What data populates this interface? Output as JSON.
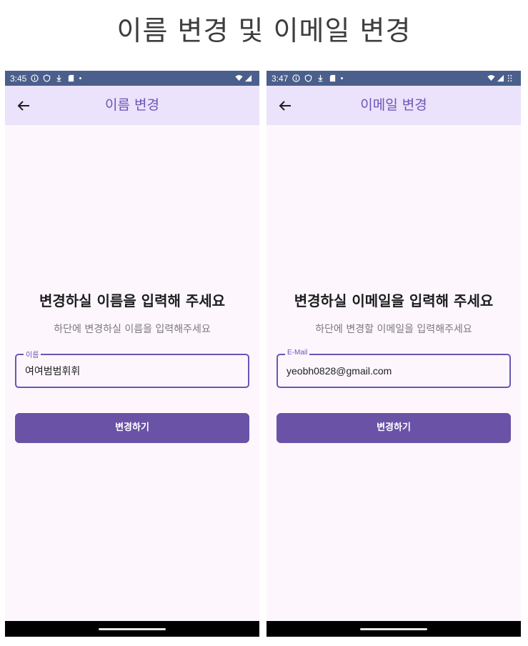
{
  "page_title": "이름 변경 및 이메일 변경",
  "screens": [
    {
      "status_bar": {
        "time": "3:45",
        "icons_left": [
          "info-circle-icon",
          "shield-icon",
          "download-icon",
          "sd-card-icon",
          "dot-icon"
        ],
        "icons_right": [
          "wifi-icon",
          "signal-icon"
        ]
      },
      "top_bar": {
        "title": "이름 변경",
        "back_icon": "arrow-back-icon"
      },
      "heading": "변경하실 이름을 입력해 주세요",
      "subheading": "하단에 변경하실 이름을 입력해주세요",
      "field": {
        "label": "이름",
        "value": "여여범범휘휘"
      },
      "button_label": "변경하기"
    },
    {
      "status_bar": {
        "time": "3:47",
        "icons_left": [
          "info-circle-icon",
          "shield-icon",
          "download-icon",
          "sd-card-icon",
          "dot-icon"
        ],
        "icons_right": [
          "wifi-icon",
          "signal-icon",
          "grid-dots-icon"
        ]
      },
      "top_bar": {
        "title": "이메일 변경",
        "back_icon": "arrow-back-icon"
      },
      "heading": "변경하실 이메일을 입력해 주세요",
      "subheading": "하단에 변경할 이메일을 입력해주세요",
      "field": {
        "label": "E-Mail",
        "value": "yeobh0828@gmail.com"
      },
      "button_label": "변경하기"
    }
  ],
  "colors": {
    "status_bar": "#4b5f8c",
    "top_bar": "#ebe2fb",
    "accent": "#6a55b5",
    "button": "#6a52a7",
    "screen_background": "#fdf7fd"
  }
}
